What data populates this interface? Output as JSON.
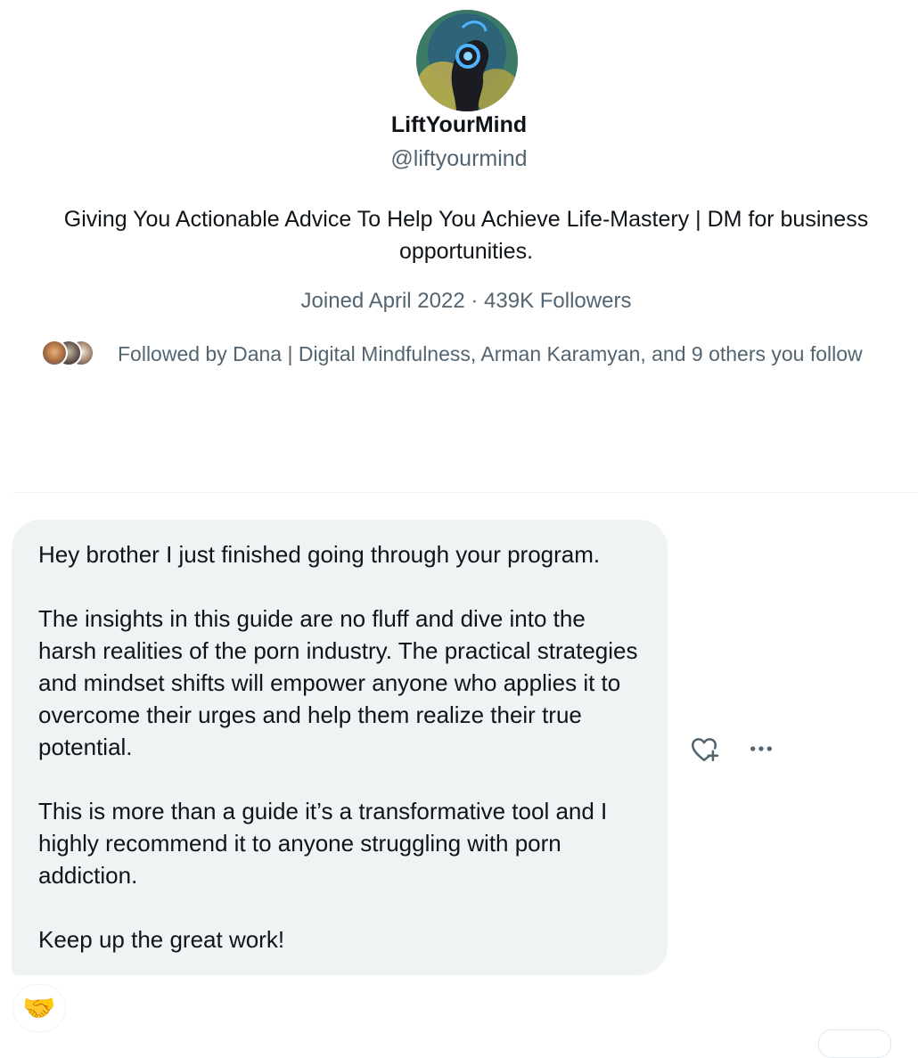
{
  "profile": {
    "display_name": "LiftYourMind",
    "handle": "@liftyourmind",
    "bio": "Giving You Actionable Advice To Help You Achieve Life-Mastery | DM for business opportunities.",
    "joined": "Joined April 2022",
    "separator": "·",
    "followers": "439K Followers",
    "followed_by": "Followed by Dana | Digital Mindfulness, Arman Karamyan, and 9 others you follow"
  },
  "message": {
    "paragraphs": [
      "Hey brother I just finished going through your program.",
      "The insights in this guide are no fluff and dive into the harsh realities of the porn industry. The practical strategies and mindset shifts will empower anyone who applies it to overcome their urges and help them realize their true potential.",
      "This is more than a guide it’s a transformative tool  and I highly recommend it to anyone struggling with porn addiction.",
      "Keep up the great work!"
    ],
    "reaction": "🤝"
  },
  "icons": {
    "add_reaction": "heart-plus-icon",
    "more": "more-icon"
  },
  "colors": {
    "primary_text": "#0f1419",
    "secondary_text": "#536471",
    "bubble_bg": "#eff3f4"
  }
}
